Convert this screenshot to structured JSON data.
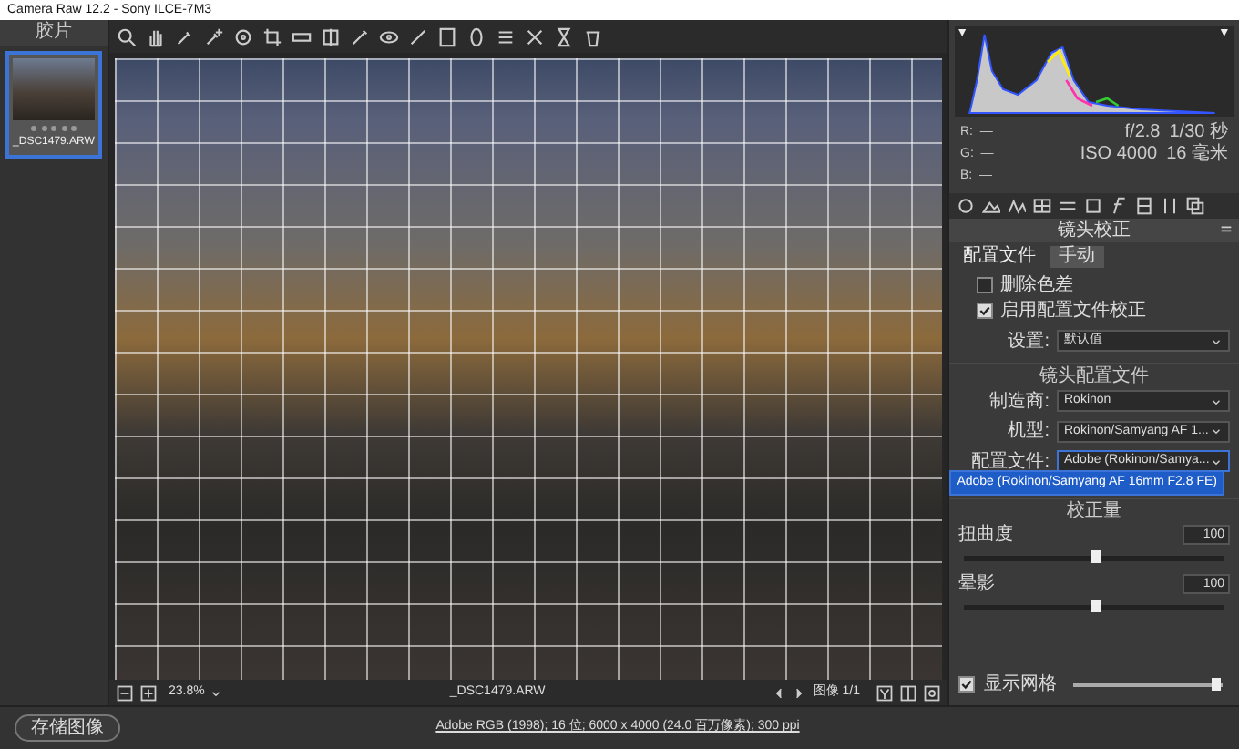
{
  "window": {
    "title": "Camera Raw 12.2  -  Sony ILCE-7M3"
  },
  "filmstrip": {
    "title": "胶片",
    "items": [
      {
        "filename": "_DSC1479.ARW",
        "selected": true,
        "stars": 0
      }
    ]
  },
  "histogram": {
    "rgb_readouts": [
      "R:  —",
      "G:  —",
      "B:  —"
    ],
    "exif": [
      [
        "f/2.8",
        "1/30 秒"
      ],
      [
        "ISO 4000",
        "16 毫米"
      ]
    ]
  },
  "panel": {
    "title": "镜头校正",
    "tabs": [
      {
        "label": "配置文件",
        "selected": true
      },
      {
        "label": "手动",
        "selected": false
      }
    ],
    "checkboxes": [
      {
        "label": "删除色差",
        "checked": false
      },
      {
        "label": "启用配置文件校正",
        "checked": true
      }
    ],
    "setup": {
      "label": "设置:",
      "value": "默认值"
    },
    "profile_section": {
      "title": "镜头配置文件",
      "fields": [
        {
          "label": "制造商:",
          "value": "Rokinon",
          "expanded": false
        },
        {
          "label": "机型:",
          "value": "Rokinon/Samyang AF 1...",
          "expanded": false
        },
        {
          "label": "配置文件:",
          "value": "Adobe (Rokinon/Samya...",
          "expanded": true
        }
      ],
      "menu_options": [
        {
          "label": "Adobe (Rokinon/Samyang AF 16mm F2.8 FE)",
          "selected": true
        }
      ]
    },
    "amount_section": {
      "title": "校正量",
      "sliders": [
        {
          "label": "扭曲度",
          "value": "100",
          "level": 0.5
        },
        {
          "label": "晕影",
          "value": "100",
          "level": 0.5
        }
      ]
    }
  },
  "grid": {
    "label": "显示网格",
    "checked": true,
    "level": 0.95
  },
  "status": {
    "zoom": "23.8%",
    "filename": "_DSC1479.ARW",
    "image_count": "图像 1/1"
  },
  "footer": {
    "save_button": "存储图像",
    "info_link": "Adobe RGB (1998); 16 位; 6000 x 4000 (24.0 百万像素); 300 ppi"
  }
}
